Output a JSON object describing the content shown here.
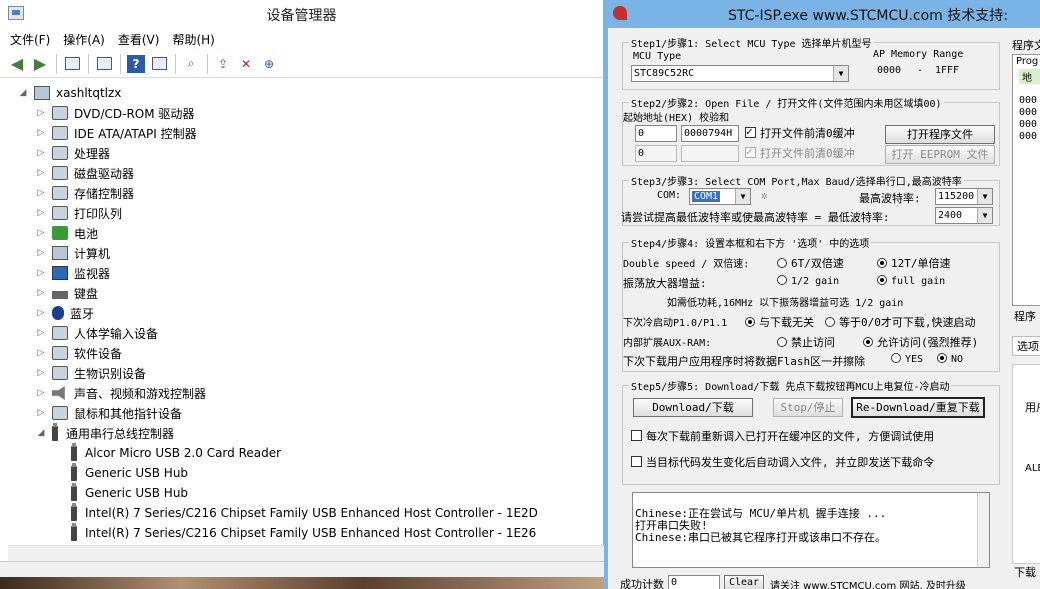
{
  "device_manager": {
    "title": "设备管理器",
    "menu": [
      "文件(F)",
      "操作(A)",
      "查看(V)",
      "帮助(H)"
    ],
    "toolbar": [
      "back-icon",
      "forward-icon",
      "properties-icon",
      "list-icon",
      "help-icon",
      "view-icon",
      "scan-icon",
      "update-driver-icon",
      "disable-icon",
      "uninstall-icon"
    ],
    "root": "xashltqtlzx",
    "categories": [
      "DVD/CD-ROM 驱动器",
      "IDE ATA/ATAPI 控制器",
      "处理器",
      "磁盘驱动器",
      "存储控制器",
      "打印队列",
      "电池",
      "计算机",
      "监视器",
      "键盘",
      "蓝牙",
      "人体学输入设备",
      "软件设备",
      "生物识别设备",
      "声音、视频和游戏控制器",
      "鼠标和其他指针设备"
    ],
    "expanded_category": "通用串行总线控制器",
    "usb_devices": [
      "Alcor Micro USB 2.0 Card Reader",
      "Generic USB Hub",
      "Generic USB Hub",
      "Intel(R) 7 Series/C216 Chipset Family USB Enhanced Host Controller - 1E2D",
      "Intel(R) 7 Series/C216 Chipset Family USB Enhanced Host Controller - 1E26"
    ]
  },
  "stc": {
    "title": "STC-ISP.exe   www.STCMCU.com 技术支持:",
    "step1": {
      "legend": "Step1/步骤1: Select MCU Type  选择单片机型号",
      "mcu_label": "MCU Type",
      "mcu_value": "STC89C52RC",
      "ap_label": "AP Memory Range",
      "ap_start": "0000",
      "ap_dash": "-",
      "ap_end": "1FFF"
    },
    "step2": {
      "legend": "Step2/步骤2: Open File / 打开文件(文件范围内未用区域填00)",
      "sub": "起始地址(HEX) 校验和",
      "addr1": "0",
      "checksum1": "0000794H",
      "clear1": "打开文件前清0缓冲",
      "open_file": "打开程序文件",
      "addr2": "0",
      "checksum2": "",
      "clear2": "打开文件前清0缓冲",
      "open_eeprom": "打开 EEPROM 文件"
    },
    "step3": {
      "legend": "Step3/步骤3: Select COM Port,Max Baud/选择串行口,最高波特率",
      "com_label": "COM:",
      "com_value": "COM1",
      "max_baud_label": "最高波特率:",
      "max_baud": "115200",
      "min_baud_hint": "请尝试提高最低波特率或使最高波特率 =  最低波特率:",
      "min_baud": "2400"
    },
    "step4": {
      "legend": "Step4/步骤4: 设置本框和右下方 '选项' 中的选项",
      "ds_label": "Double speed / 双倍速:",
      "ds_opt1": "6T/双倍速",
      "ds_opt2": "12T/单倍速",
      "gain_label": "振荡放大器增益:",
      "gain_opt1": "1/2 gain",
      "gain_opt2": "full gain",
      "gain_hint": "如需低功耗,16MHz 以下振荡器增益可选 1/2 gain",
      "cold_label": "下次冷启动P1.0/P1.1",
      "cold_opt1": "与下载无关",
      "cold_opt2": "等于0/0才可下载,快速启动",
      "aux_label": "内部扩展AUX-RAM:",
      "aux_opt1": "禁止访问",
      "aux_opt2": "允许访问(强烈推荐)",
      "erase_label": "下次下载用户应用程序时将数据Flash区一并擦除",
      "erase_yes": "YES",
      "erase_no": "NO"
    },
    "step5": {
      "legend": "Step5/步骤5: Download/下载  先点下载按钮再MCU上电复位-冷启动",
      "download": "Download/下载",
      "stop": "Stop/停止",
      "redownload": "Re-Download/重复下载",
      "opt1": "每次下载前重新调入已打开在缓冲区的文件, 方便调试使用",
      "opt2": "当目标代码发生变化后自动调入文件, 并立即发送下载命令"
    },
    "log": [
      "Chinese:正在尝试与 MCU/单片机 握手连接 ...",
      "打开串口失败!",
      "Chinese:串口已被其它程序打开或该串口不存在。"
    ],
    "status": {
      "count_label": "成功计数",
      "count": "0",
      "clear": "Clear",
      "note": "请关注 www.STCMCU.com 网站, 及时升级"
    },
    "right_panel": {
      "top_label": "程序文",
      "prog": "Prog",
      "addr_tab": "地",
      "rows": [
        "000",
        "000",
        "000",
        "000"
      ],
      "label2": "程序",
      "options": "选项",
      "user": "用户",
      "ale": "ALE",
      "download": "下载"
    }
  }
}
